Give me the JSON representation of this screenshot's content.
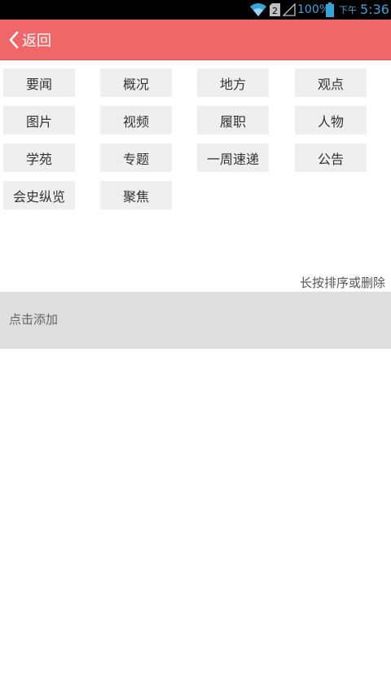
{
  "status_bar": {
    "battery_percent": "100%",
    "ampm": "下午",
    "time": "5:36",
    "accent_color": "#35a4d7",
    "icons": [
      "wifi-icon",
      "sim-icon",
      "signal-icon",
      "battery-icon"
    ]
  },
  "title_bar": {
    "back_label": "返回",
    "background_color": "#f0676a"
  },
  "channels": [
    {
      "label": "要闻"
    },
    {
      "label": "概况"
    },
    {
      "label": "地方"
    },
    {
      "label": "观点"
    },
    {
      "label": "图片"
    },
    {
      "label": "视频"
    },
    {
      "label": "履职"
    },
    {
      "label": "人物"
    },
    {
      "label": "学苑"
    },
    {
      "label": "专题"
    },
    {
      "label": "一周速递"
    },
    {
      "label": "公告"
    },
    {
      "label": "会史纵览"
    },
    {
      "label": "聚焦"
    }
  ],
  "hint": "长按排序或删除",
  "add_section": {
    "label": "点击添加"
  }
}
